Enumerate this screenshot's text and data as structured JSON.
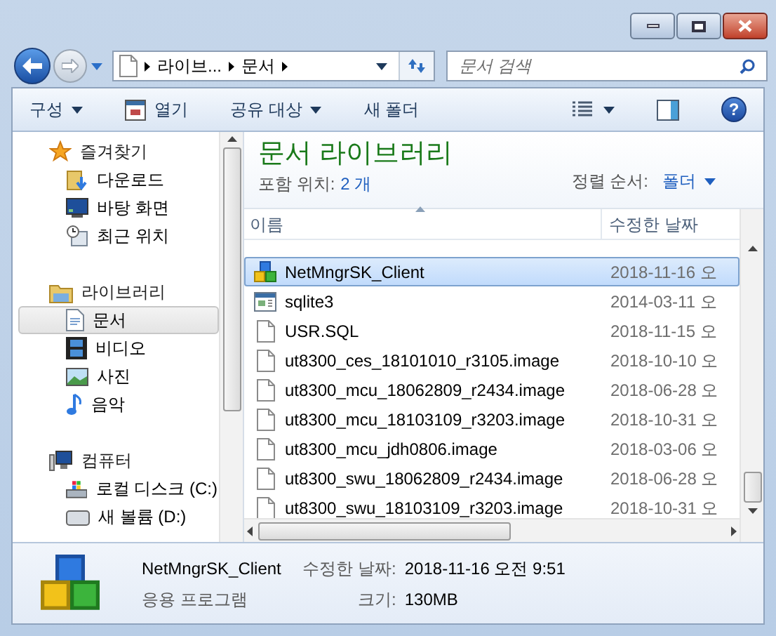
{
  "address": {
    "crumbs": [
      "라이브...",
      "문서"
    ]
  },
  "search": {
    "placeholder": "문서 검색"
  },
  "help": {
    "label": "?"
  },
  "toolbar": [
    {
      "label": "구성",
      "has_menu": true
    },
    {
      "label": "열기",
      "has_menu": false
    },
    {
      "label": "공유 대상",
      "has_menu": true
    },
    {
      "label": "새 폴더",
      "has_menu": false
    }
  ],
  "sidebar": [
    {
      "label": "즐겨찾기",
      "children": [
        {
          "label": "다운로드",
          "selected": false
        },
        {
          "label": "바탕 화면",
          "selected": false
        },
        {
          "label": "최근 위치",
          "selected": false
        }
      ]
    },
    {
      "label": "라이브러리",
      "children": [
        {
          "label": "문서",
          "selected": true
        },
        {
          "label": "비디오",
          "selected": false
        },
        {
          "label": "사진",
          "selected": false
        },
        {
          "label": "음악",
          "selected": false
        }
      ]
    },
    {
      "label": "컴퓨터",
      "children": [
        {
          "label": "로컬 디스크 (C:)",
          "selected": false
        },
        {
          "label": "새 볼륨 (D:)",
          "selected": false
        }
      ]
    }
  ],
  "library": {
    "title": "문서 라이브러리",
    "includes_label": "포함 위치:",
    "includes_link": "2 개",
    "sort_label": "정렬 순서:",
    "sort_value": "폴더"
  },
  "table": {
    "columns": [
      "이름",
      "수정한 날짜"
    ],
    "rows": [
      {
        "kind": "application",
        "name": "NetMngrSK_Client",
        "date": "2018-11-16 오",
        "selected": true
      },
      {
        "kind": "program",
        "name": "sqlite3",
        "date": "2014-03-11 오",
        "selected": false
      },
      {
        "kind": "file",
        "name": "USR.SQL",
        "date": "2018-11-15 오",
        "selected": false
      },
      {
        "kind": "file",
        "name": "ut8300_ces_18101010_r3105.image",
        "date": "2018-10-10 오",
        "selected": false
      },
      {
        "kind": "file",
        "name": "ut8300_mcu_18062809_r2434.image",
        "date": "2018-06-28 오",
        "selected": false
      },
      {
        "kind": "file",
        "name": "ut8300_mcu_18103109_r3203.image",
        "date": "2018-10-31 오",
        "selected": false
      },
      {
        "kind": "file",
        "name": "ut8300_mcu_jdh0806.image",
        "date": "2018-03-06 오",
        "selected": false
      },
      {
        "kind": "file",
        "name": "ut8300_swu_18062809_r2434.image",
        "date": "2018-06-28 오",
        "selected": false
      },
      {
        "kind": "file",
        "name": "ut8300_swu_18103109_r3203.image",
        "date": "2018-10-31 오",
        "selected": false
      }
    ]
  },
  "details": {
    "name": "NetMngrSK_Client",
    "type": "응용 프로그램",
    "fields": [
      {
        "label": "수정한 날짜:",
        "value": "2018-11-16 오전 9:51"
      },
      {
        "label": "크기:",
        "value": "130MB"
      }
    ]
  }
}
